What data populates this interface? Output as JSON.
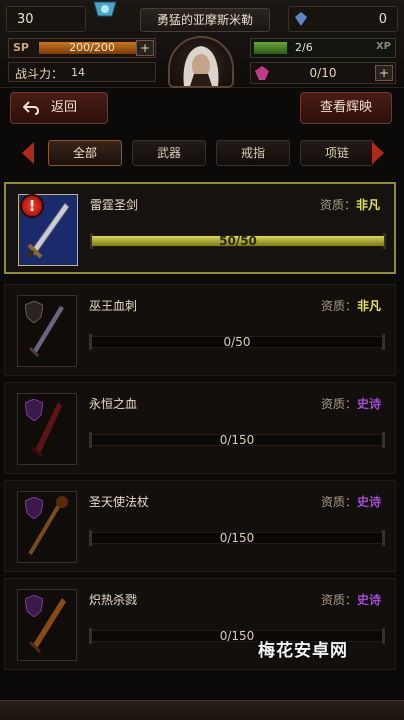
{
  "hud": {
    "gold": "30",
    "player_name": "勇猛的亚摩斯米勒",
    "crystals": "0",
    "sp_label": "SP",
    "sp_value": "200/200",
    "sp_ratio": 1.0,
    "power_label": "战斗力：",
    "power_value": "14",
    "xp_value": "2/6",
    "xp_ratio": 0.333,
    "xp_label": "XP",
    "fragments": "0/10",
    "plus": "+"
  },
  "buttons": {
    "back": "返回",
    "collection": "查看辉映"
  },
  "tabs": [
    {
      "label": "全部",
      "active": true
    },
    {
      "label": "武器",
      "active": false
    },
    {
      "label": "戒指",
      "active": false
    },
    {
      "label": "项链",
      "active": false
    }
  ],
  "items": [
    {
      "name": "雷霆圣剑",
      "quality_label": "资质：",
      "quality": "非凡",
      "quality_class": "rare",
      "progress": "50/50",
      "ratio": 1.0,
      "selected": true,
      "alert": "!"
    },
    {
      "name": "巫王血刺",
      "quality_label": "资质：",
      "quality": "非凡",
      "quality_class": "rare",
      "progress": "0/50",
      "ratio": 0,
      "selected": false
    },
    {
      "name": "永恒之血",
      "quality_label": "资质：",
      "quality": "史诗",
      "quality_class": "epic",
      "progress": "0/150",
      "ratio": 0,
      "selected": false
    },
    {
      "name": "圣天使法杖",
      "quality_label": "资质：",
      "quality": "史诗",
      "quality_class": "epic",
      "progress": "0/150",
      "ratio": 0,
      "selected": false
    },
    {
      "name": "炽热杀戮",
      "quality_label": "资质：",
      "quality": "史诗",
      "quality_class": "epic",
      "progress": "0/150",
      "ratio": 0,
      "selected": false
    }
  ],
  "watermark": "梅花安卓网",
  "colors": {
    "rare": "#e6e060",
    "epic": "#a04ad0",
    "accent_border": "#8f8d3a"
  }
}
